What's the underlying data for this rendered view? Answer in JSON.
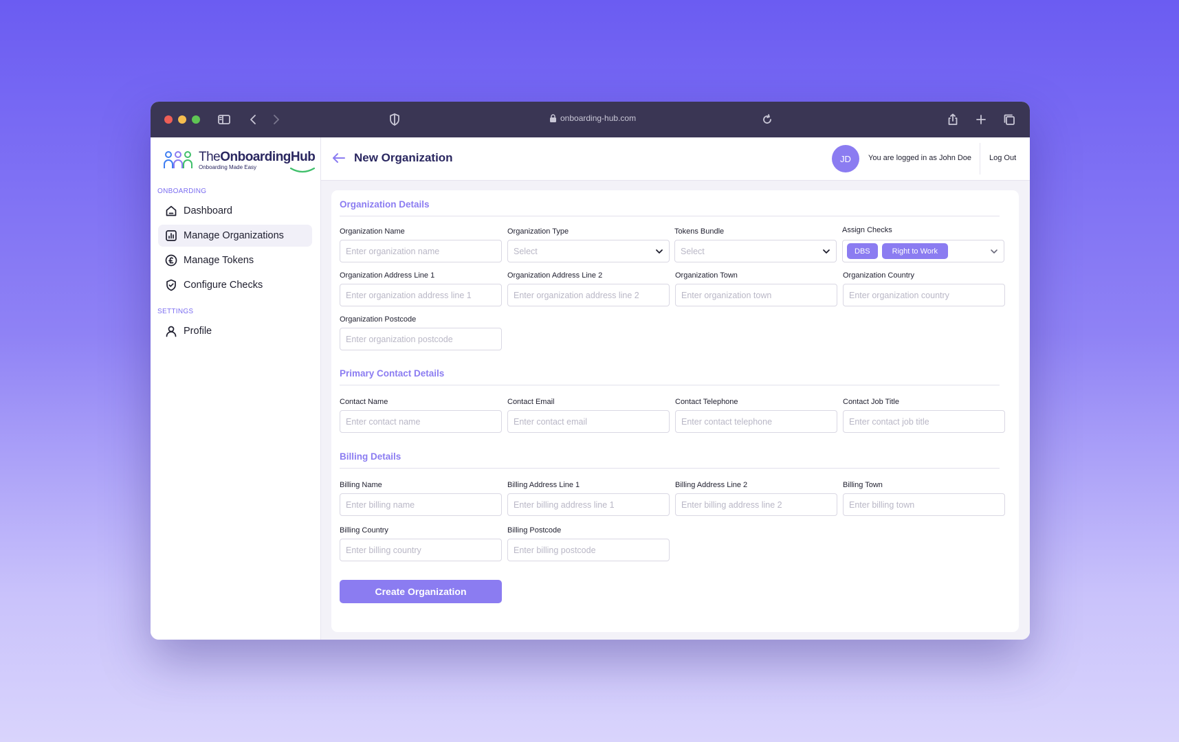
{
  "browser": {
    "url": "onboarding-hub.com",
    "icons": [
      "sidebar-toggle-icon",
      "back-icon",
      "forward-icon",
      "shield-icon",
      "lock-icon",
      "reload-icon",
      "share-icon",
      "plus-icon",
      "tabs-icon"
    ]
  },
  "brand": {
    "name_prefix": "The",
    "name_main": "OnboardingHub",
    "tagline": "Onboarding Made Easy",
    "colors": {
      "navy": "#2a2760",
      "accent": "#8b7cf1",
      "green": "#3fbf6a",
      "blue": "#3f7ef2"
    }
  },
  "sidebar": {
    "section_onboarding": "ONBOARDING",
    "section_settings": "SETTINGS",
    "items": [
      {
        "label": "Dashboard",
        "icon": "home-icon"
      },
      {
        "label": "Manage Organizations",
        "icon": "chart-icon",
        "active": true
      },
      {
        "label": "Manage Tokens",
        "icon": "pound-icon"
      },
      {
        "label": "Configure Checks",
        "icon": "shield-check-icon"
      },
      {
        "label": "Profile",
        "icon": "user-icon"
      }
    ]
  },
  "header": {
    "title": "New Organization",
    "avatar_initials": "JD",
    "login_text": "You are logged in as John Doe",
    "logout_label": "Log Out"
  },
  "form": {
    "org_section": "Organization Details",
    "org_name": {
      "label": "Organization Name",
      "placeholder": "Enter organization name"
    },
    "org_type": {
      "label": "Organization Type",
      "value": "Select"
    },
    "tokens_bundle": {
      "label": "Tokens Bundle",
      "value": "Select"
    },
    "assign_checks": {
      "label": "Assign Checks",
      "chips": [
        "DBS",
        "Right to Work"
      ]
    },
    "addr1": {
      "label": "Organization Address Line 1",
      "placeholder": "Enter organization address line 1"
    },
    "addr2": {
      "label": "Organization Address Line 2",
      "placeholder": "Enter organization address line 2"
    },
    "town": {
      "label": "Organization Town",
      "placeholder": "Enter organization town"
    },
    "country": {
      "label": "Organization Country",
      "placeholder": "Enter organization country"
    },
    "postcode": {
      "label": "Organization Postcode",
      "placeholder": "Enter organization postcode"
    },
    "contact_section": "Primary Contact Details",
    "contact_name": {
      "label": "Contact Name",
      "placeholder": "Enter contact name"
    },
    "contact_email": {
      "label": "Contact Email",
      "placeholder": "Enter contact email"
    },
    "contact_phone": {
      "label": "Contact Telephone",
      "placeholder": "Enter contact telephone"
    },
    "contact_job": {
      "label": "Contact Job Title",
      "placeholder": "Enter contact job title"
    },
    "billing_section": "Billing Details",
    "billing_name": {
      "label": "Billing Name",
      "placeholder": "Enter billing name"
    },
    "billing_addr1": {
      "label": "Billing Address Line 1",
      "placeholder": "Enter billing address line 1"
    },
    "billing_addr2": {
      "label": "Billing Address Line 2",
      "placeholder": "Enter billing address line 2"
    },
    "billing_town": {
      "label": "Billing Town",
      "placeholder": "Enter billing town"
    },
    "billing_country": {
      "label": "Billing Country",
      "placeholder": "Enter billing country"
    },
    "billing_postcode": {
      "label": "Billing Postcode",
      "placeholder": "Enter billing postcode"
    },
    "submit_label": "Create Organization"
  }
}
